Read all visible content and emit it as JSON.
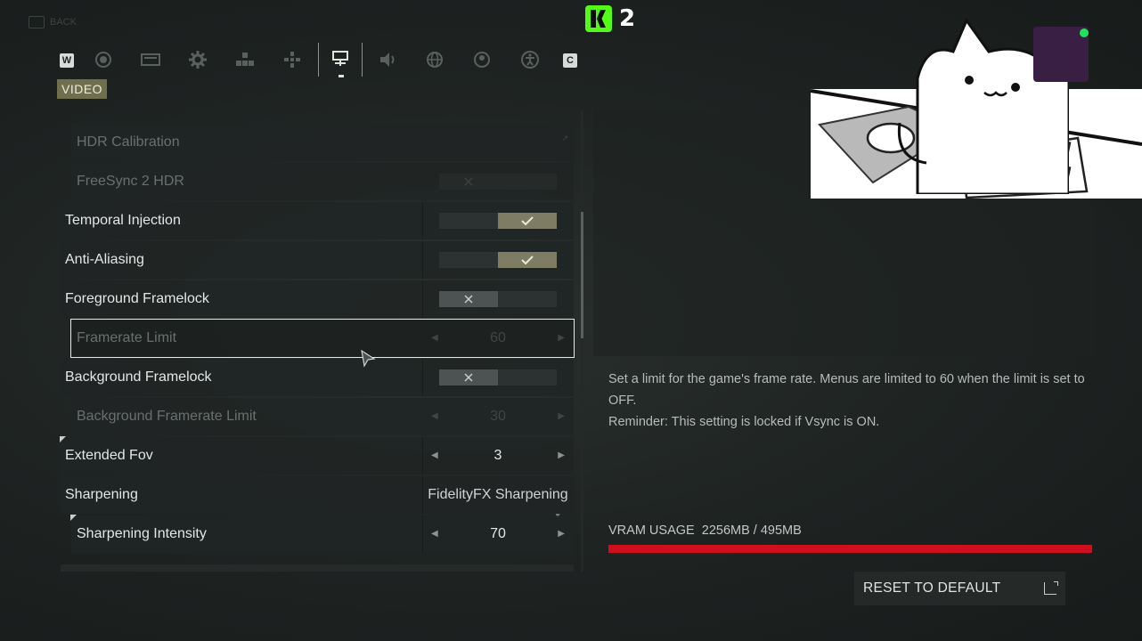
{
  "header": {
    "back_label": "BACK",
    "stream_count": "2",
    "section_title": "VIDEO",
    "left_bumper": "W",
    "right_bumper": "C"
  },
  "tabs": [
    {
      "name": "tab-general",
      "icon": "circle-icon"
    },
    {
      "name": "tab-display",
      "icon": "monitor-icon"
    },
    {
      "name": "tab-gameplay",
      "icon": "gear-icon"
    },
    {
      "name": "tab-keybinds",
      "icon": "keyboard-icon"
    },
    {
      "name": "tab-controller",
      "icon": "dpad-icon"
    },
    {
      "name": "tab-video",
      "icon": "video-settings-icon",
      "active": true
    },
    {
      "name": "tab-audio",
      "icon": "speaker-icon"
    },
    {
      "name": "tab-network",
      "icon": "globe-icon"
    },
    {
      "name": "tab-social",
      "icon": "person-icon"
    },
    {
      "name": "tab-accessibility",
      "icon": "accessibility-icon"
    }
  ],
  "settings": [
    {
      "label": "HDR Calibration",
      "type": "link",
      "disabled": true,
      "indent": true
    },
    {
      "label": "FreeSync 2 HDR",
      "type": "toggle",
      "value": false,
      "disabled": true,
      "indent": true
    },
    {
      "label": "Temporal Injection",
      "type": "toggle",
      "value": true
    },
    {
      "label": "Anti-Aliasing",
      "type": "toggle",
      "value": true
    },
    {
      "label": "Foreground Framelock",
      "type": "toggle",
      "value": false
    },
    {
      "label": "Framerate Limit",
      "type": "stepper",
      "value": "60",
      "disabled": true,
      "indent": true,
      "selected": true
    },
    {
      "label": "Background Framelock",
      "type": "toggle",
      "value": false
    },
    {
      "label": "Background Framerate Limit",
      "type": "stepper",
      "value": "30",
      "disabled": true,
      "indent": true
    },
    {
      "label": "Extended Fov",
      "type": "stepper",
      "value": "3"
    },
    {
      "label": "Sharpening",
      "type": "dropdown",
      "value": "FidelityFX Sharpening"
    },
    {
      "label": "Sharpening Intensity",
      "type": "stepper",
      "value": "70",
      "indent": true
    }
  ],
  "description": {
    "line1": "Set a limit for the game's frame rate. Menus are limited to 60 when the limit is set to OFF.",
    "line2": "Reminder: This setting is locked if Vsync is ON."
  },
  "vram": {
    "label": "VRAM USAGE",
    "value": "2256MB / 495MB",
    "used_mb": 2256,
    "total_mb": 495,
    "bar_fill": 1.0,
    "bar_color": "#d00f1e"
  },
  "actions": {
    "reset_label": "RESET TO DEFAULT"
  },
  "colors": {
    "accent": "#7e7c63",
    "stream_brand": "#53fc18",
    "warning_bar": "#d00f1e"
  }
}
